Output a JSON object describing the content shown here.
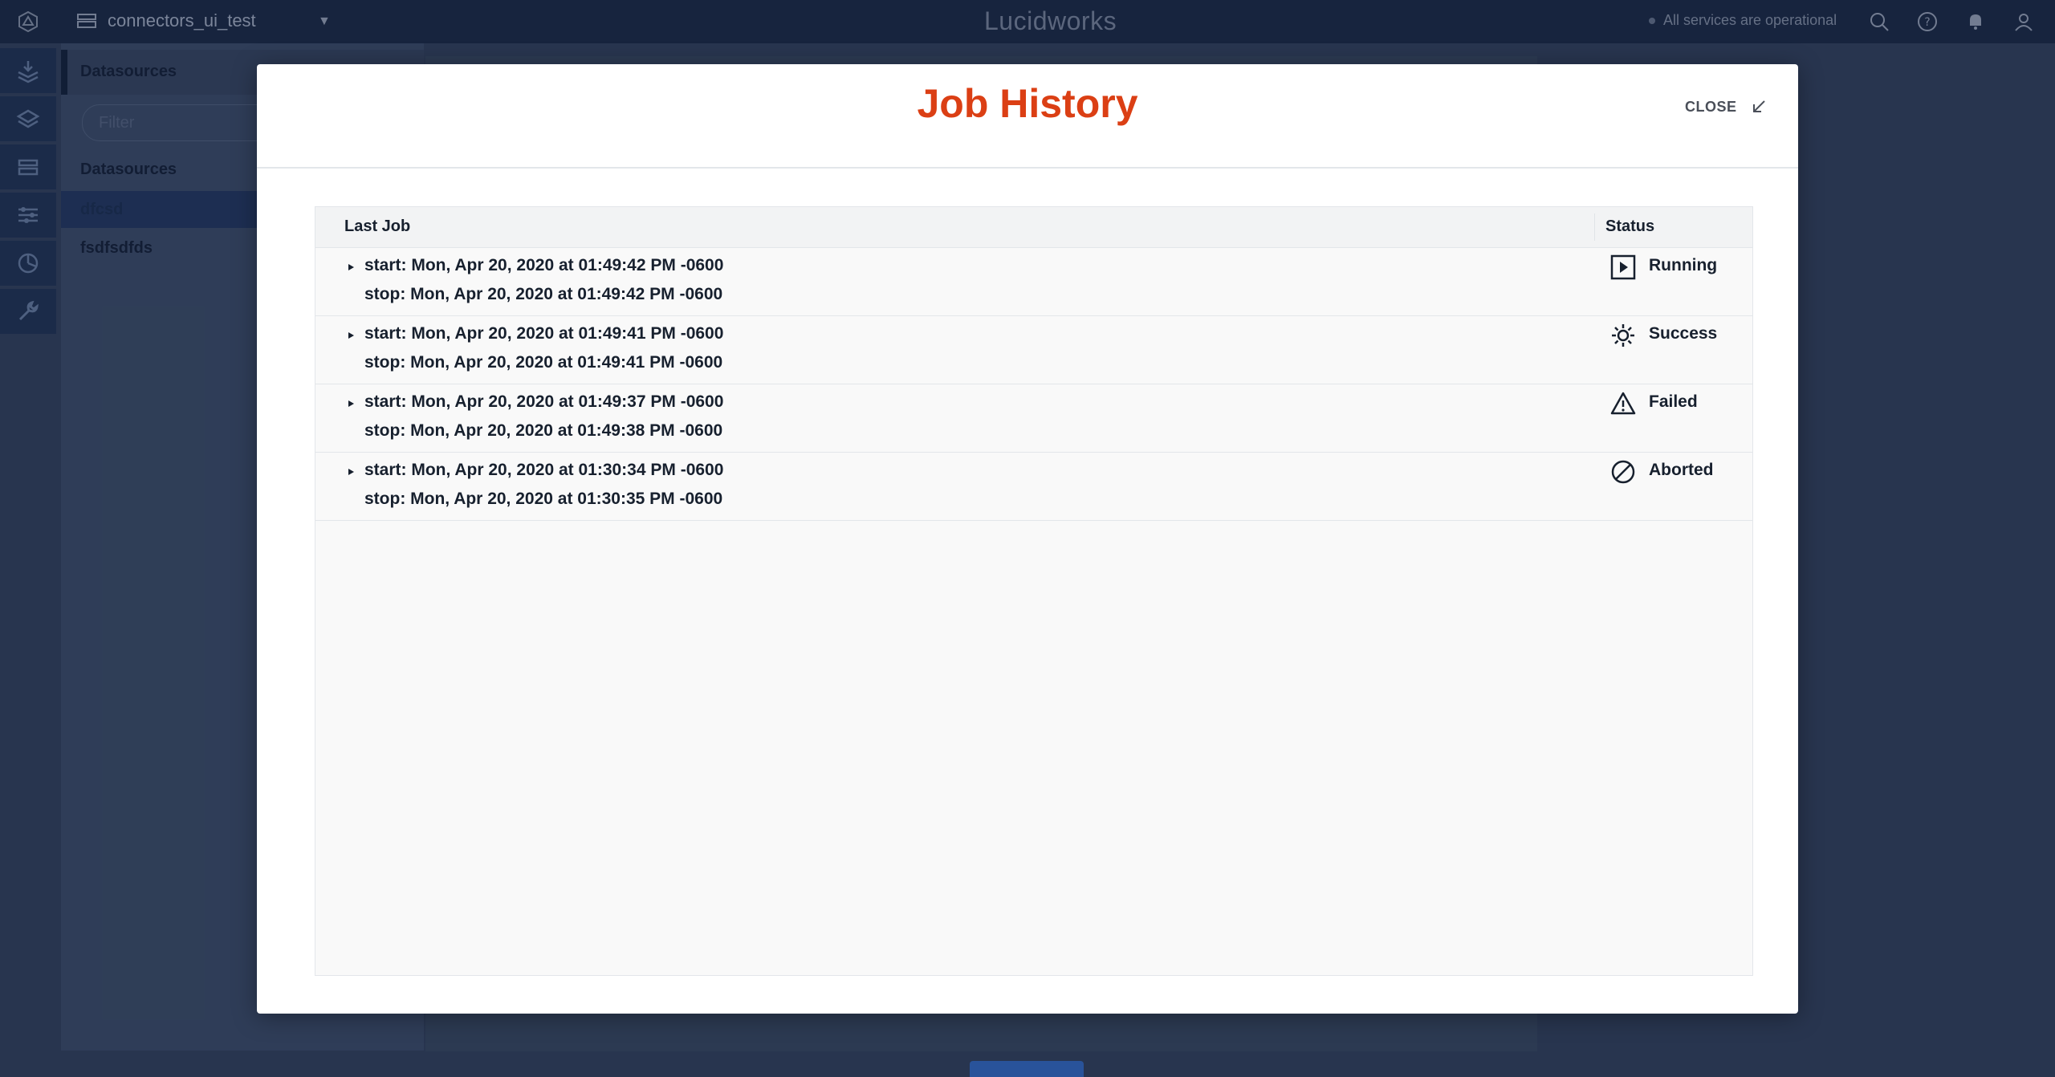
{
  "app": {
    "project": "connectors_ui_test",
    "brand": "Lucidworks",
    "services_status": "All services are operational"
  },
  "panel": {
    "heading": "Datasources",
    "filter_placeholder": "Filter",
    "section_label": "Datasources",
    "items": [
      "dfcsd",
      "fsdfsdfds"
    ]
  },
  "modal": {
    "title": "Job History",
    "close_label": "CLOSE",
    "columns": {
      "job": "Last Job",
      "status": "Status"
    },
    "rows": [
      {
        "start": "start: Mon, Apr 20, 2020 at 01:49:42 PM -0600",
        "stop": "stop: Mon, Apr 20, 2020 at 01:49:42 PM -0600",
        "status": "Running",
        "icon": "play-icon"
      },
      {
        "start": "start: Mon, Apr 20, 2020 at 01:49:41 PM -0600",
        "stop": "stop: Mon, Apr 20, 2020 at 01:49:41 PM -0600",
        "status": "Success",
        "icon": "sun-icon"
      },
      {
        "start": "start: Mon, Apr 20, 2020 at 01:49:37 PM -0600",
        "stop": "stop: Mon, Apr 20, 2020 at 01:49:38 PM -0600",
        "status": "Failed",
        "icon": "warning-icon"
      },
      {
        "start": "start: Mon, Apr 20, 2020 at 01:30:34 PM -0600",
        "stop": "stop: Mon, Apr 20, 2020 at 01:30:35 PM -0600",
        "status": "Aborted",
        "icon": "aborted-icon"
      }
    ]
  },
  "colors": {
    "title": "#db3f14",
    "topbar": "#15233e",
    "backdrop": "#2b3a55"
  }
}
